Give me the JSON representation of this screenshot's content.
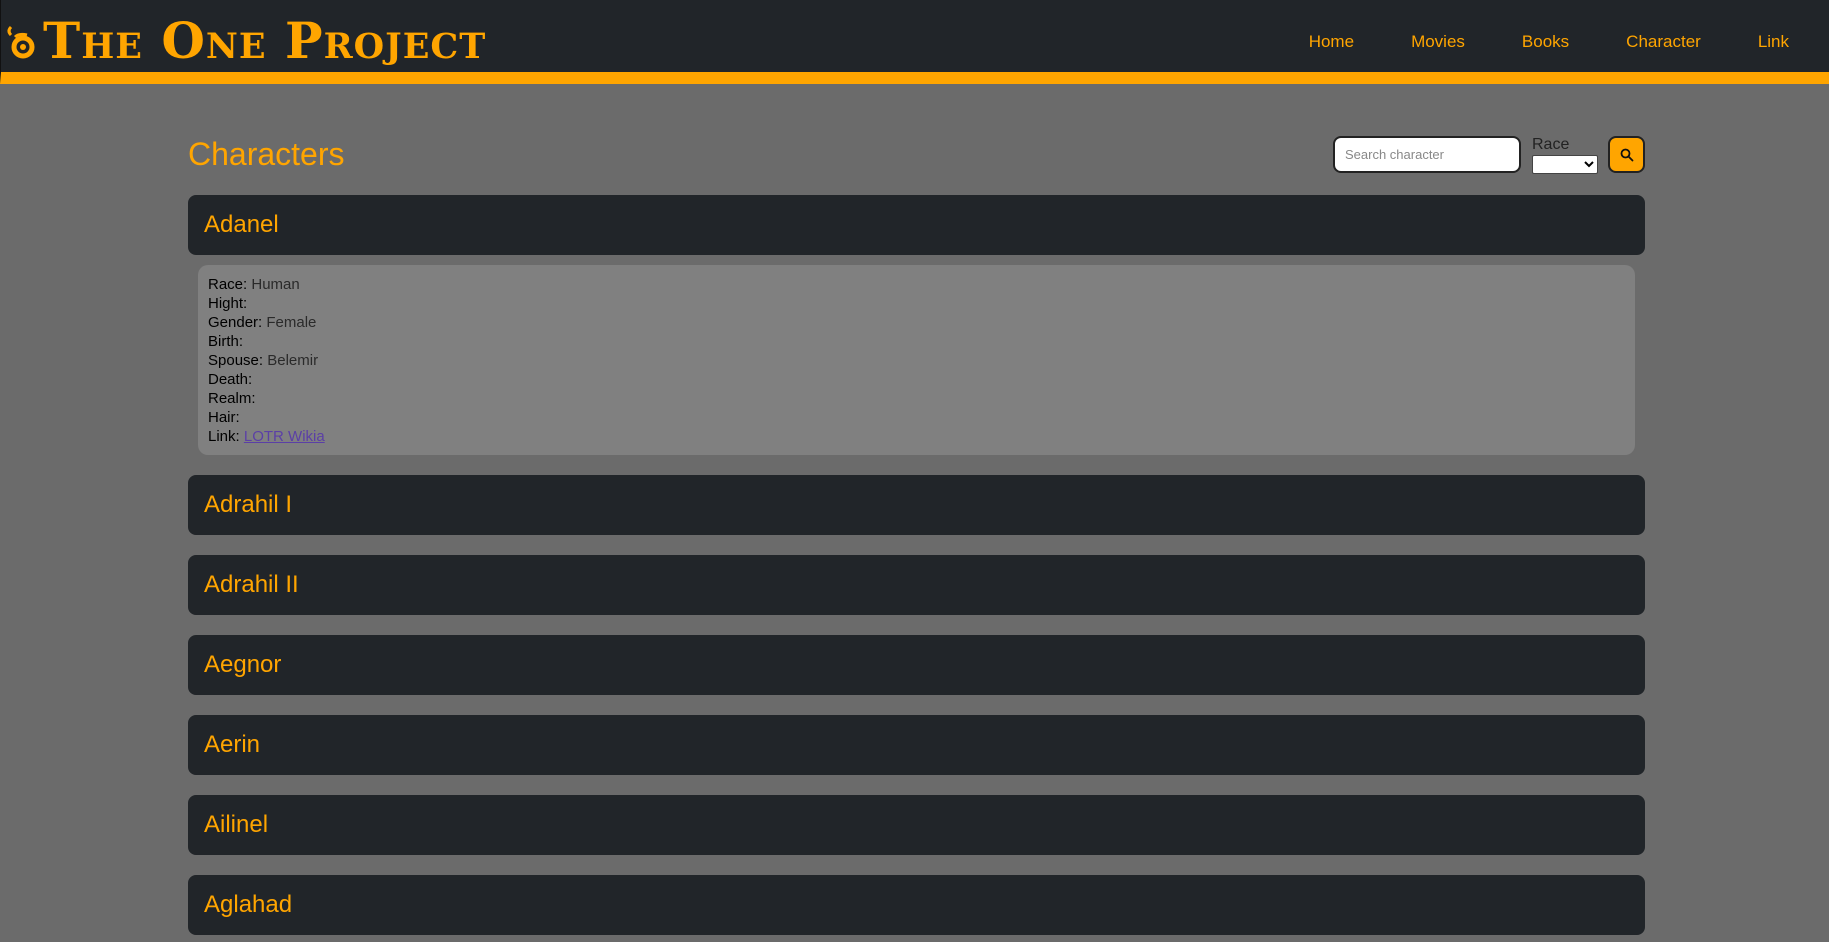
{
  "header": {
    "brand": "The One Project",
    "nav": [
      "Home",
      "Movies",
      "Books",
      "Character",
      "Link"
    ]
  },
  "page": {
    "title": "Characters",
    "search_placeholder": "Search character",
    "race_label": "Race",
    "race_selected": ""
  },
  "characters": [
    "Adanel",
    "Adrahil I",
    "Adrahil II",
    "Aegnor",
    "Aerin",
    "Ailinel",
    "Aglahad"
  ],
  "details": {
    "race_label": "Race:",
    "race": "Human",
    "hight_label": "Hight:",
    "hight": "",
    "gender_label": "Gender:",
    "gender": "Female",
    "birth_label": "Birth:",
    "birth": "",
    "spouse_label": "Spouse:",
    "spouse": "Belemir",
    "death_label": "Death:",
    "death": "",
    "realm_label": "Realm:",
    "realm": "",
    "hair_label": "Hair:",
    "hair": "",
    "link_label": "Link:",
    "link_text": "LOTR Wikia"
  },
  "colors": {
    "accent": "#ffa500",
    "header_bg": "#212529",
    "page_bg": "#6b6b6b",
    "detail_bg": "#808080"
  },
  "icons": {
    "logo": "ring-swirl-icon",
    "search": "search-icon"
  }
}
